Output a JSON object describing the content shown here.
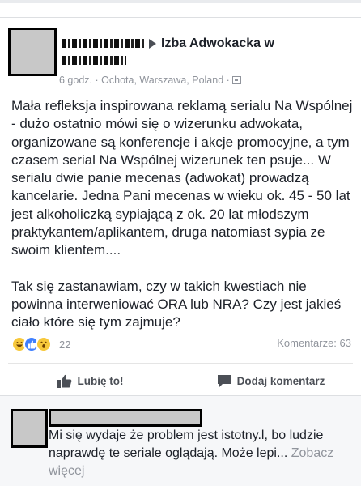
{
  "post": {
    "group_name": "Izba Adwokacka w",
    "meta": {
      "time": "6 godz.",
      "separator": "·",
      "location": "Ochota, Warszawa, Poland",
      "separator2": "·"
    },
    "body": [
      "Mała refleksja inspirowana reklamą serialu Na Wspólnej - dużo ostatnio mówi się o wizerunku adwokata, organizowane są konferencje i akcje promocyjne, a tym czasem serial Na Wspólnej wizerunek ten psuje... W serialu dwie panie mecenas (adwokat) prowadzą kancelarie. Jedna Pani mecenas w wieku ok. 45 - 50 lat jest alkoholiczką sypiającą z ok. 20 lat młodszym praktykantem/aplikantem, druga natomiast sypia ze swoim klientem....",
      "Tak się zastanawiam, czy w takich kwestiach nie powinna interweniować ORA lub NRA? Czy jest jakieś ciało które się tym zajmuje?"
    ],
    "reactions_count": "22",
    "comments_count": "Komentarze: 63",
    "like_label": "Lubię to!",
    "comment_label": "Dodaj komentarz"
  },
  "comment": {
    "text": "Mi się wydaje że problem jest istotny.l, bo ludzie naprawdę te seriale oglądają. Może lepi...",
    "see_more": "Zobacz więcej"
  },
  "colors": {
    "like_blue": "#4080ff",
    "secondary_text": "#90949c",
    "action_text": "#4b4f56"
  }
}
